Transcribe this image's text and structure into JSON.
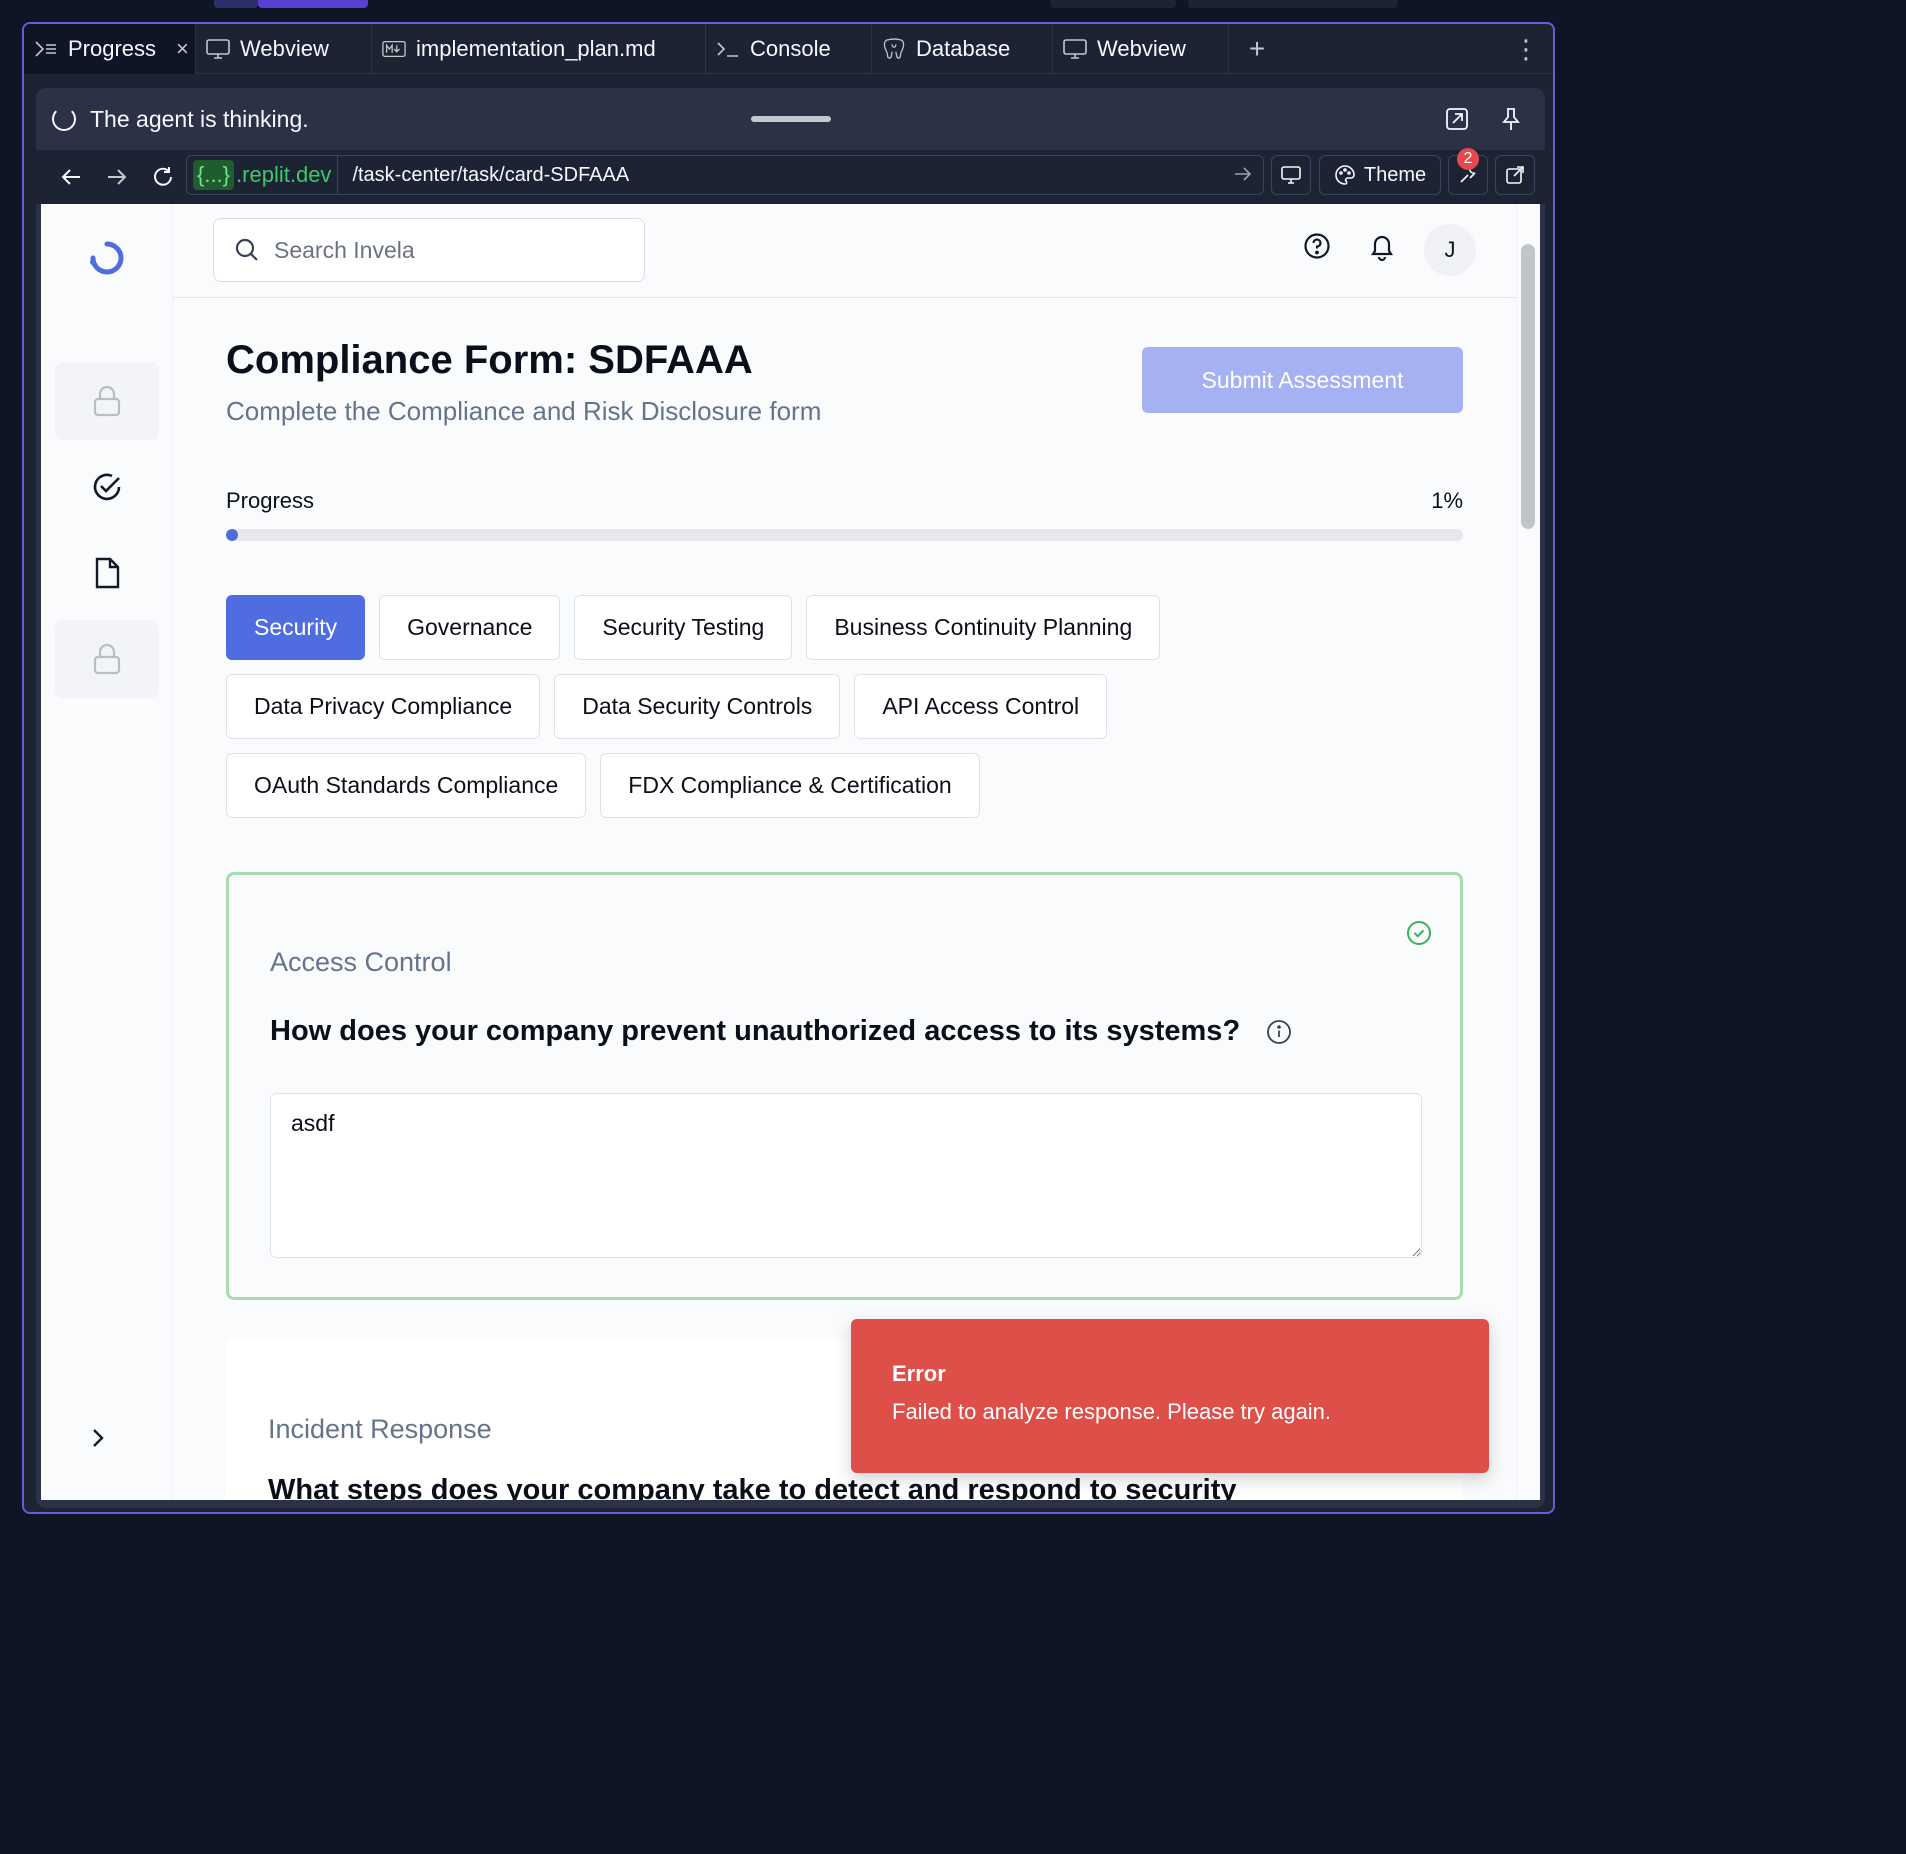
{
  "ide": {
    "tabs": [
      {
        "icon": "progress-icon",
        "label": "Progress",
        "closable": true
      },
      {
        "icon": "monitor-icon",
        "label": "Webview"
      },
      {
        "icon": "markdown-icon",
        "label": "implementation_plan.md"
      },
      {
        "icon": "terminal-icon",
        "label": "Console"
      },
      {
        "icon": "database-icon",
        "label": "Database"
      },
      {
        "icon": "monitor-icon",
        "label": "Webview"
      }
    ],
    "status_text": "The agent is thinking.",
    "url_host_prefix": "{...}",
    "url_host": ".replit.dev",
    "url_path": "/task-center/task/card-SDFAAA",
    "theme_label": "Theme",
    "devtools_badge": "2"
  },
  "app": {
    "search_placeholder": "Search Invela",
    "avatar_initial": "J",
    "page_title": "Compliance Form: SDFAAA",
    "page_subtitle": "Complete the Compliance and Risk Disclosure form",
    "submit_label": "Submit Assessment",
    "progress_label": "Progress",
    "progress_text": "1%",
    "progress_fraction": 0.01,
    "section_tabs": [
      "Security",
      "Governance",
      "Security Testing",
      "Business Continuity Planning",
      "Data Privacy Compliance",
      "Data Security Controls",
      "API Access Control",
      "OAuth Standards Compliance",
      "FDX Compliance & Certification"
    ],
    "active_tab": "Security",
    "questions": [
      {
        "section": "Access Control",
        "question": "How does your company prevent unauthorized access to its systems?",
        "answer": "asdf",
        "completed": true
      },
      {
        "section": "Incident Response",
        "question": "What steps does your company take to detect and respond to security"
      }
    ],
    "toast": {
      "title": "Error",
      "message": "Failed to analyze response. Please try again."
    }
  },
  "colors": {
    "accent": "#4f6ce0",
    "frame": "#6e5ad6",
    "success_border": "#a6dcae",
    "error": "#de4f4a"
  }
}
